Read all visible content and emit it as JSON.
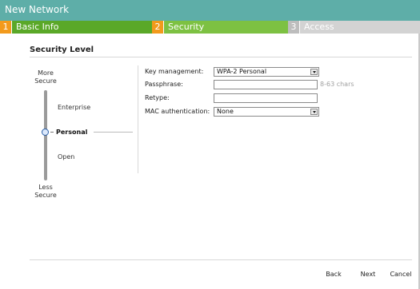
{
  "window": {
    "title": "New Network"
  },
  "steps": [
    {
      "num": "1",
      "label": "Basic Info"
    },
    {
      "num": "2",
      "label": "Security"
    },
    {
      "num": "3",
      "label": "Access"
    }
  ],
  "section": {
    "title": "Security Level"
  },
  "security_level": {
    "top_label": [
      "More",
      "Secure"
    ],
    "bottom_label": [
      "Less",
      "Secure"
    ],
    "levels": [
      "Enterprise",
      "Personal",
      "Open"
    ],
    "selected": "Personal"
  },
  "form": {
    "key_management": {
      "label": "Key management:",
      "value": "WPA-2 Personal"
    },
    "passphrase": {
      "label": "Passphrase:",
      "value": "",
      "hint": "8-63 chars"
    },
    "retype": {
      "label": "Retype:",
      "value": ""
    },
    "mac_auth": {
      "label": "MAC authentication:",
      "value": "None"
    }
  },
  "buttons": {
    "back": "Back",
    "next": "Next",
    "cancel": "Cancel"
  },
  "colors": {
    "titlebar": "#5eaea8",
    "step_number_active": "#f29a1c",
    "step_basic_info": "#5aa828",
    "step_security": "#7dc142",
    "step_inactive": "#d3d3d3",
    "slider_knob": "#2a5fa8"
  }
}
